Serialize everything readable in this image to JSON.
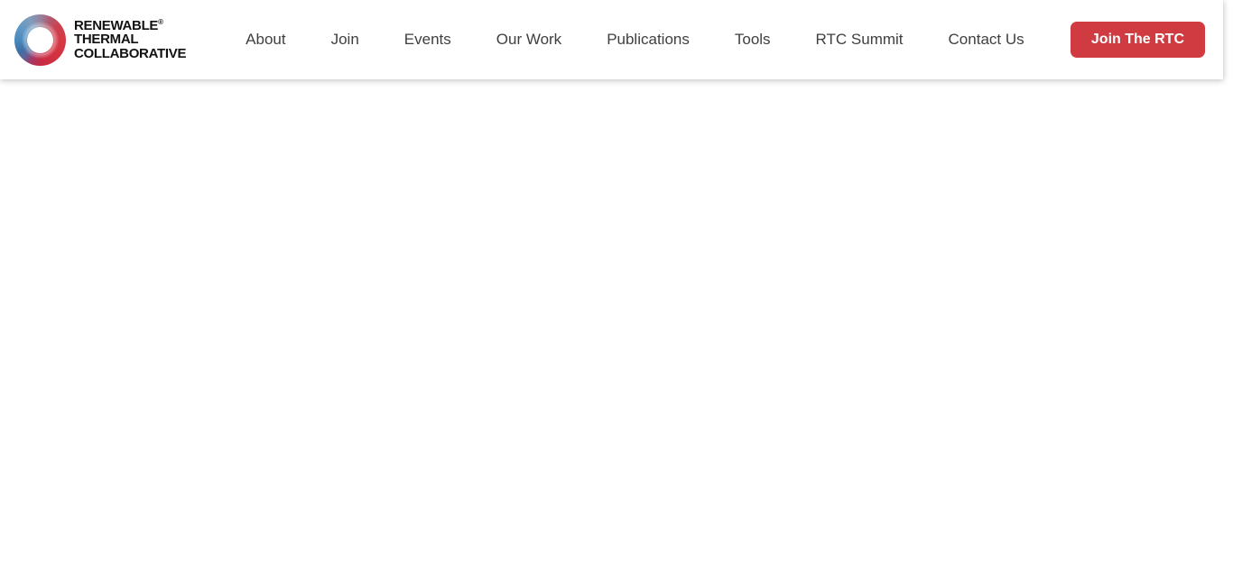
{
  "header": {
    "logo": {
      "line1": "RENEWABLE",
      "registered": "®",
      "line2": "THERMAL",
      "line3": "COLLABORATIVE"
    },
    "nav": {
      "items": [
        "About",
        "Join",
        "Events",
        "Our Work",
        "Publications",
        "Tools",
        "RTC Summit",
        "Contact Us"
      ]
    },
    "cta": {
      "label": "Join The RTC"
    }
  },
  "colors": {
    "accent_red": "#d03b41",
    "nav_text": "#3f3f3f",
    "logo_text": "#121212",
    "logo_ring_red": "#d63845",
    "logo_ring_blue": "#4889bc",
    "header_background": "#ffffff",
    "page_background": "#ffffff"
  }
}
